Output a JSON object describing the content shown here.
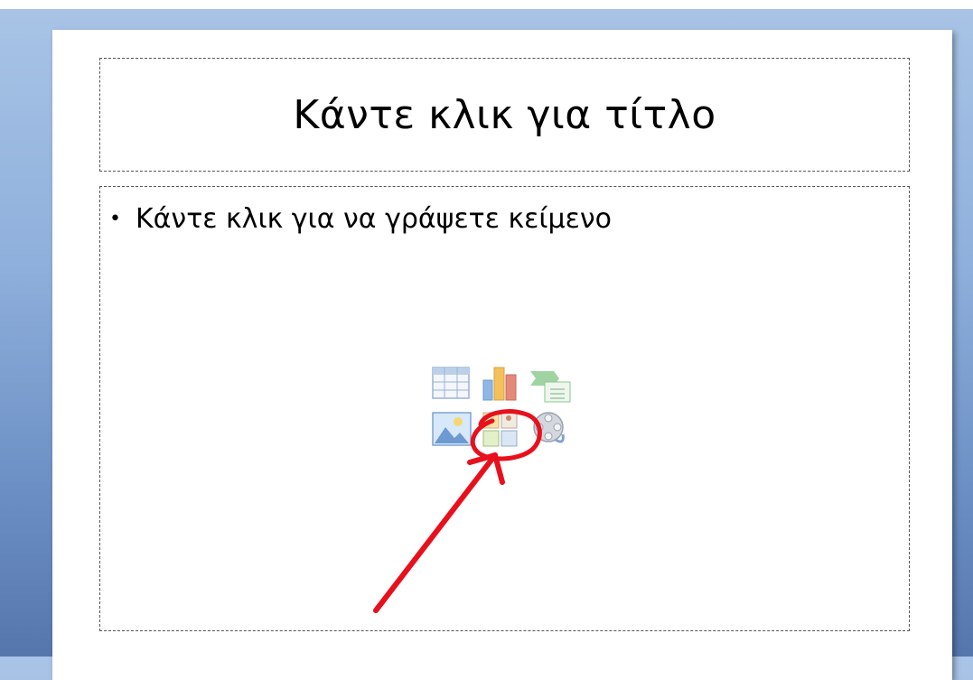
{
  "slide": {
    "title_placeholder": "Κάντε κλικ για τίτλο",
    "content_placeholder": "Κάντε κλικ για να γράψετε κείμενο",
    "bullet": "•"
  },
  "content_icons": [
    {
      "name": "insert-table-icon"
    },
    {
      "name": "insert-chart-icon"
    },
    {
      "name": "insert-smartart-icon"
    },
    {
      "name": "insert-picture-icon"
    },
    {
      "name": "insert-clipart-icon"
    },
    {
      "name": "insert-media-icon"
    }
  ],
  "annotation": {
    "color": "#e8101c"
  }
}
